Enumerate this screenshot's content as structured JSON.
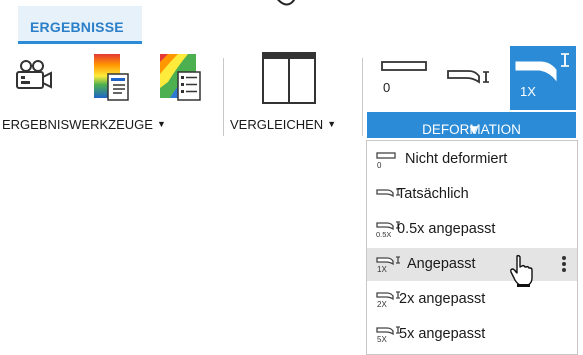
{
  "ribbon": {
    "tab_label": "ERGEBNISSE"
  },
  "groups": {
    "ergebniswerkzeuge": {
      "label": "ERGEBNISWERKZEUGE"
    },
    "vergleichen": {
      "label": "VERGLEICHEN"
    },
    "deformation": {
      "label": "DEFORMATION",
      "buttons": [
        {
          "icon": "undeformed-icon",
          "caption": "0"
        },
        {
          "icon": "actual-deformation-icon",
          "caption": ""
        },
        {
          "icon": "adjusted-deformation-icon",
          "caption": "1X",
          "active": true
        }
      ]
    }
  },
  "menu": {
    "items": [
      {
        "label": "Nicht deformiert",
        "icon": "undeformed-icon",
        "icon_caption": "0"
      },
      {
        "label": "Tatsächlich",
        "icon": "actual-deformation-icon",
        "icon_caption": ""
      },
      {
        "label": "0.5x angepasst",
        "icon": "scale-0-5x-icon",
        "icon_caption": "0.5X"
      },
      {
        "label": "Angepasst",
        "icon": "adjusted-deformation-icon",
        "icon_caption": "1X",
        "highlighted": true
      },
      {
        "label": "2x angepasst",
        "icon": "scale-2x-icon",
        "icon_caption": "2X"
      },
      {
        "label": "5x angepasst",
        "icon": "scale-5x-icon",
        "icon_caption": "5X"
      }
    ]
  },
  "colors": {
    "accent": "#2b8bd6",
    "tab_background": "#e7f1f9",
    "highlight": "#e4e4e4"
  }
}
